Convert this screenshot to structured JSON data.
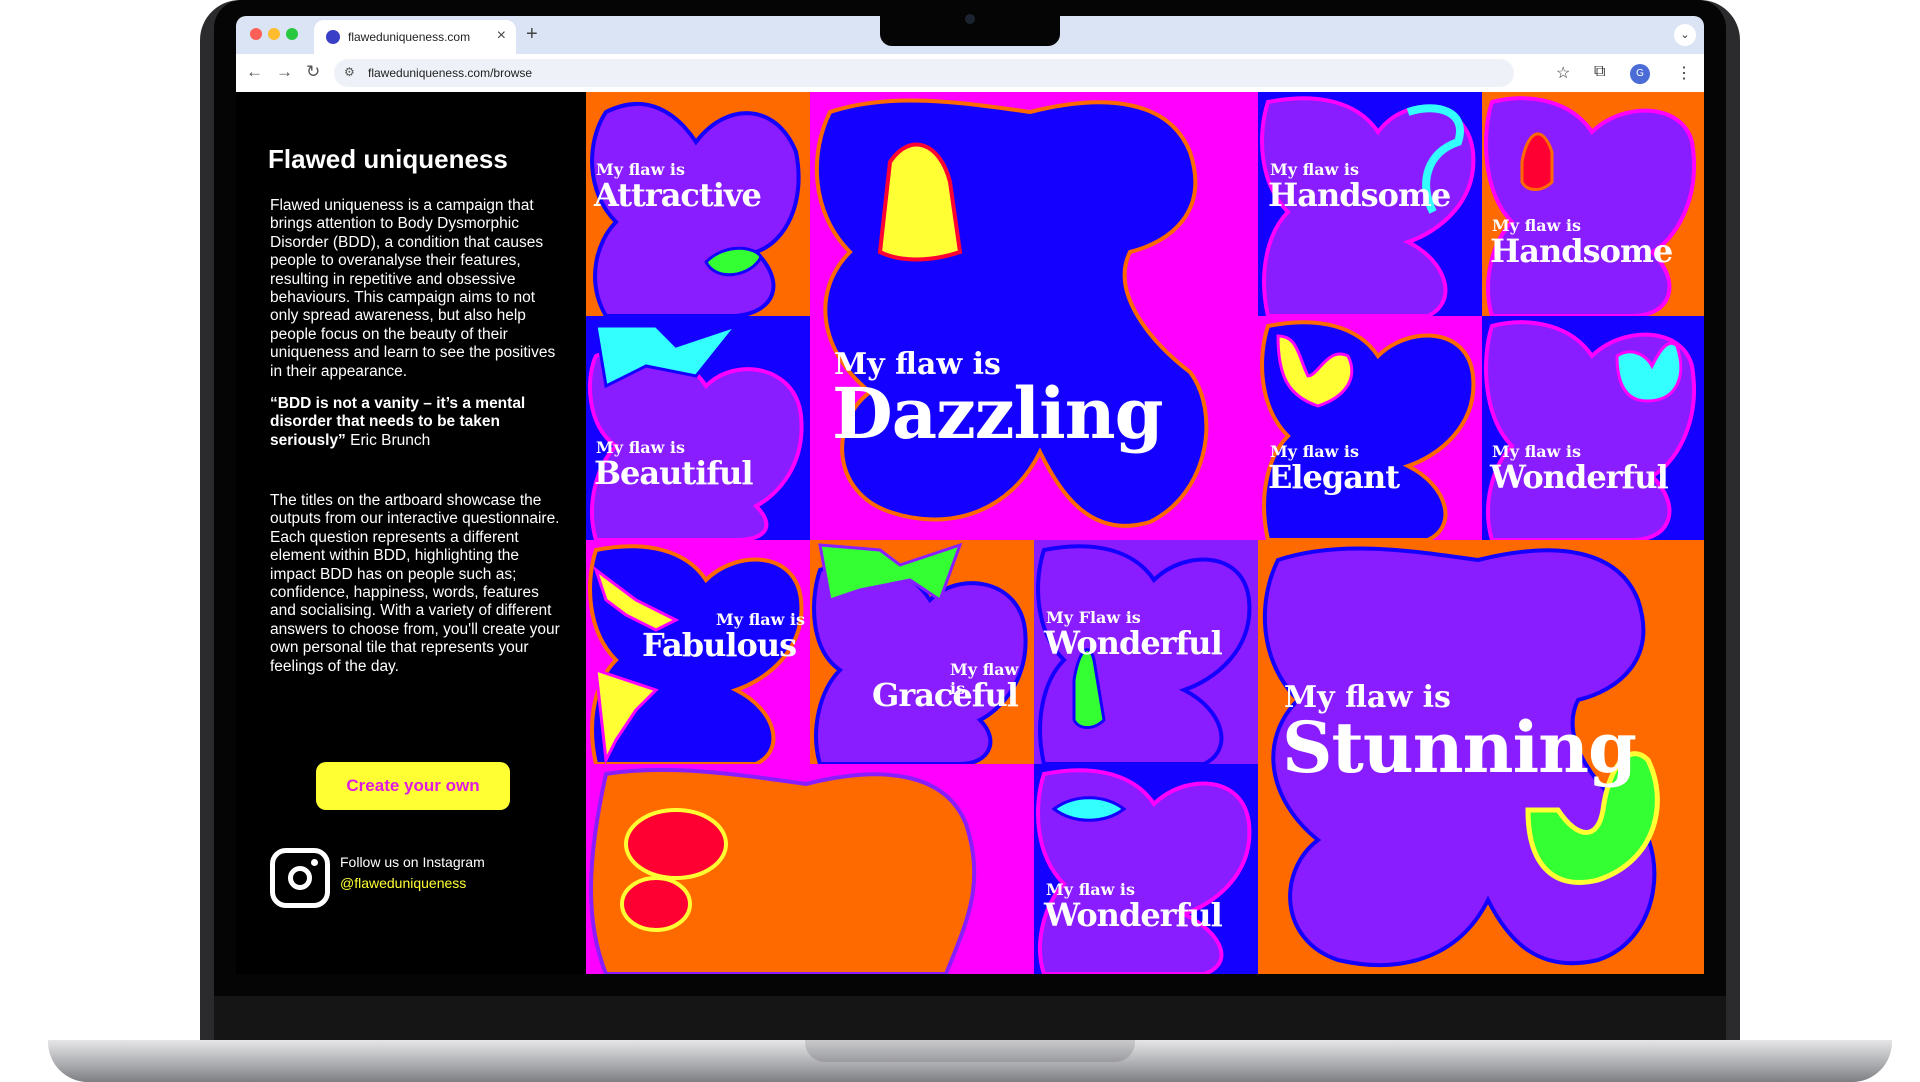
{
  "browser": {
    "tab_title": "flaweduniqueness.com",
    "url": "flaweduniqueness.com/browse",
    "profile_initial": "G"
  },
  "sidebar": {
    "title": "Flawed uniqueness",
    "description": "Flawed uniqueness is a campaign that brings attention to Body Dysmorphic Disorder (BDD), a condition that causes people to overanalyse their features, resulting in repetitive and obsessive behaviours. This campaign aims to not only spread awareness, but also help people focus on the beauty of their uniqueness and learn to see the positives in their appearance.",
    "quote": "“BDD is not a vanity –  it’s a mental disorder that needs to be taken seriously”",
    "quote_author": " Eric Brunch",
    "description2": "The titles on the artboard showcase the outputs from our interactive questionnaire. Each question represents a different element within BDD, highlighting the impact BDD has on people such as; confidence, happiness, words, features and socialising. With a variety of different answers to choose from, you'll create your own personal tile that represents your feelings of the day.",
    "cta_label": "Create your own",
    "instagram_follow": "Follow us on Instagram",
    "instagram_handle": "@flaweduniqueness"
  },
  "tiles": [
    {
      "prefix": "My flaw is",
      "word": "Attractive"
    },
    {
      "prefix": "My flaw is",
      "word": "Dazzling"
    },
    {
      "prefix": "My flaw is",
      "word": "Handsome"
    },
    {
      "prefix": "My flaw is",
      "word": "Handsome"
    },
    {
      "prefix": "My flaw is",
      "word": "Beautiful"
    },
    {
      "prefix": "My flaw is",
      "word": "Elegant"
    },
    {
      "prefix": "My flaw is",
      "word": "Wonderful"
    },
    {
      "prefix": "My flaw is",
      "word": "Fabulous"
    },
    {
      "prefix": "My flaw is",
      "word": "Graceful"
    },
    {
      "prefix": "My Flaw is",
      "word": "Wonderful"
    },
    {
      "prefix": "My flaw is",
      "word": "Stunning"
    },
    {
      "prefix": "My flaw is",
      "word": "Wonderful"
    }
  ],
  "colors": {
    "magenta": "#ff00ff",
    "orange": "#ff6a00",
    "blue": "#1400ff",
    "purple": "#8a1dff",
    "yellow": "#ffff33",
    "cta_text": "#e01be0"
  }
}
